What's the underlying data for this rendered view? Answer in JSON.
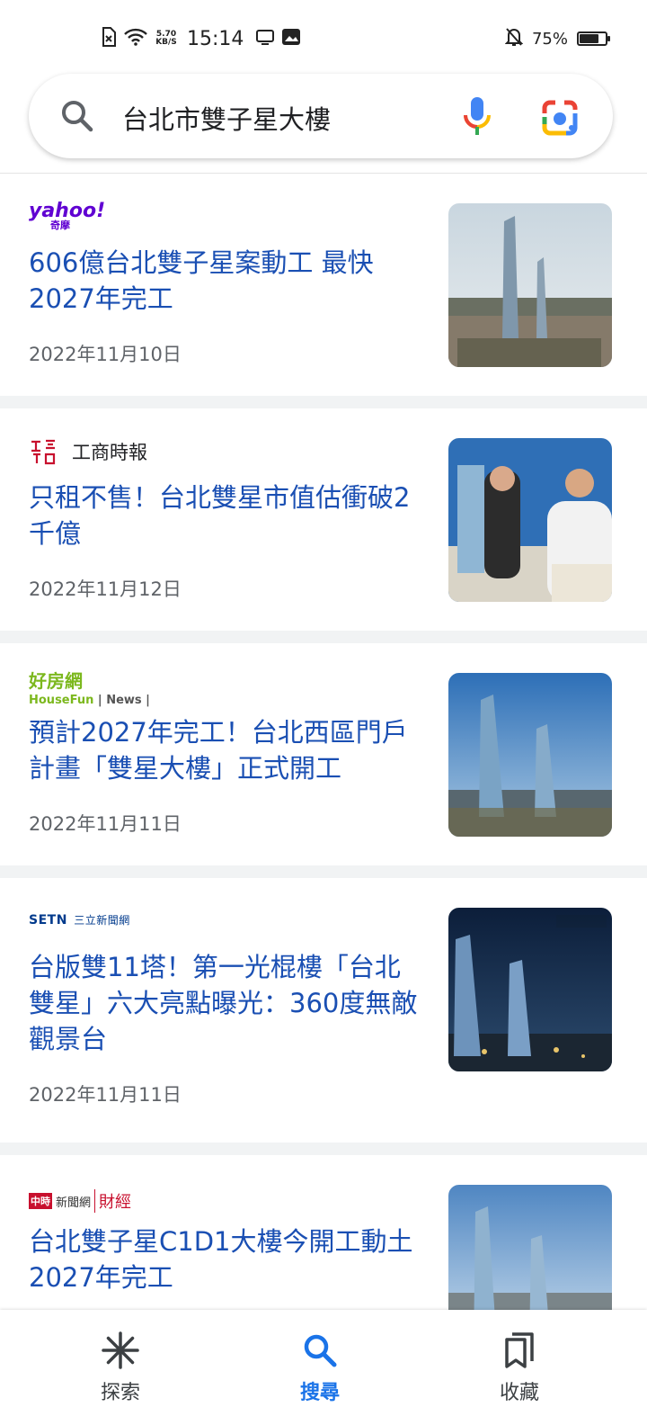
{
  "status_bar": {
    "net_speed_value": "5.70",
    "net_speed_unit": "KB/S",
    "time": "15:14",
    "battery_percent": "75%",
    "battery_level": 0.75
  },
  "search": {
    "query": "台北市雙子星大樓"
  },
  "results": [
    {
      "source": "yahoo!",
      "source_sub": "奇摩",
      "title": "606億台北雙子星案動工 最快2027年完工",
      "date": "2022年11月10日"
    },
    {
      "source": "工商時報",
      "source_logo": "工商時報",
      "title": "只租不售！台北雙星市值估衝破2千億",
      "date": "2022年11月12日"
    },
    {
      "source": "好房網",
      "source_sub": "HouseFun",
      "source_sub2": "News",
      "title": "預計2027年完工！台北西區門戶計畫「雙星大樓」正式開工",
      "date": "2022年11月11日"
    },
    {
      "source": "SETN",
      "source_sub": "三立新聞網",
      "title": "台版雙11塔！第一光棍樓「台北雙星」六大亮點曝光：360度無敵觀景台",
      "date": "2022年11月11日"
    },
    {
      "source": "中時",
      "source_sub": "新聞網",
      "source_sub2": "財經",
      "title": "台北雙子星C1D1大樓今開工動土 2027年完工",
      "date": ""
    }
  ],
  "bottom_nav": {
    "items": [
      {
        "label": "探索",
        "icon": "asterisk-icon"
      },
      {
        "label": "搜尋",
        "icon": "search-icon"
      },
      {
        "label": "收藏",
        "icon": "bookmarks-icon"
      }
    ],
    "active": "搜尋"
  },
  "colors": {
    "title_link": "#1a4fb3",
    "active_nav": "#1a73e8",
    "yahoo": "#6001d2",
    "housefun": "#7cb81e"
  }
}
